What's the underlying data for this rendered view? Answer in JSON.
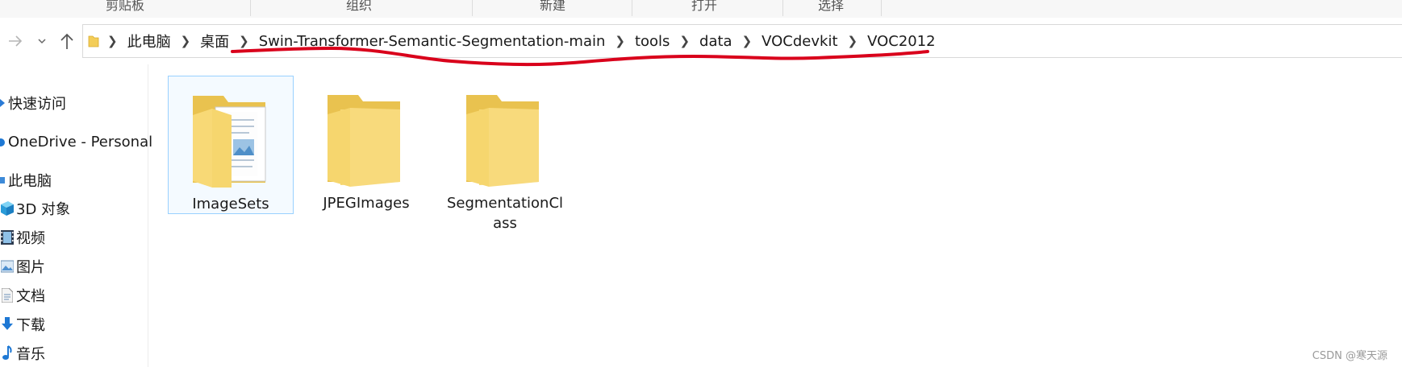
{
  "ribbon": {
    "groups": [
      "剪贴板",
      "组织",
      "新建",
      "打开",
      "选择"
    ]
  },
  "address": {
    "path": [
      "此电脑",
      "桌面",
      "Swin-Transformer-Semantic-Segmentation-main",
      "tools",
      "data",
      "VOCdevkit",
      "VOC2012"
    ],
    "annotation_color": "#d9001b"
  },
  "sidebar": {
    "items": [
      {
        "label": "快速访问",
        "icon": "star-icon"
      },
      {
        "label": "OneDrive - Personal",
        "icon": "cloud-icon"
      },
      {
        "label": "此电脑",
        "icon": "computer-icon"
      },
      {
        "label": "3D 对象",
        "icon": "cube-icon"
      },
      {
        "label": "视频",
        "icon": "film-icon"
      },
      {
        "label": "图片",
        "icon": "picture-icon"
      },
      {
        "label": "文档",
        "icon": "document-icon"
      },
      {
        "label": "下载",
        "icon": "download-icon"
      },
      {
        "label": "音乐",
        "icon": "music-icon"
      }
    ]
  },
  "files": [
    {
      "name": "ImageSets",
      "selected": true,
      "type": "folder-with-files"
    },
    {
      "name": "JPEGImages",
      "selected": false,
      "type": "folder"
    },
    {
      "name": "SegmentationCl\nass",
      "selected": false,
      "type": "folder"
    }
  ],
  "watermark": "CSDN @寒天源"
}
